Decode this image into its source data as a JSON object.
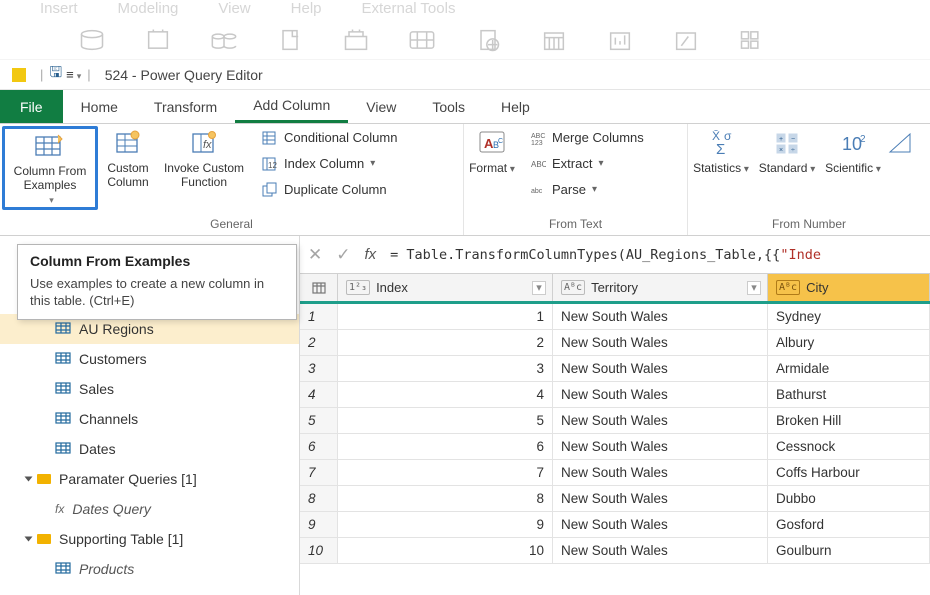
{
  "bgmenu": [
    "Insert",
    "Modeling",
    "View",
    "Help",
    "External Tools"
  ],
  "title": "524 - Power Query Editor",
  "tabs": {
    "file": "File",
    "home": "Home",
    "transform": "Transform",
    "addcolumn": "Add Column",
    "view": "View",
    "tools": "Tools",
    "help": "Help"
  },
  "ribbon": {
    "col_from_examples": "Column From\nExamples",
    "custom_column": "Custom\nColumn",
    "invoke_custom": "Invoke Custom\nFunction",
    "conditional": "Conditional Column",
    "index": "Index Column",
    "duplicate": "Duplicate Column",
    "general": "General",
    "format": "Format",
    "merge": "Merge Columns",
    "extract": "Extract",
    "parse": "Parse",
    "from_text": "From Text",
    "statistics": "Statistics",
    "standard": "Standard",
    "scientific": "Scientific",
    "from_number": "From Number"
  },
  "tooltip": {
    "title": "Column From Examples",
    "body": "Use examples to create a new column in this table. (Ctrl+E)"
  },
  "queries": {
    "items": [
      {
        "label": "AU Regions",
        "type": "table",
        "selected": true
      },
      {
        "label": "Customers",
        "type": "table"
      },
      {
        "label": "Sales",
        "type": "table"
      },
      {
        "label": "Channels",
        "type": "table"
      },
      {
        "label": "Dates",
        "type": "table"
      }
    ],
    "groups": [
      {
        "label": "Paramater Queries [1]",
        "items": [
          {
            "label": "Dates Query",
            "type": "fx"
          }
        ]
      },
      {
        "label": "Supporting Table [1]",
        "items": [
          {
            "label": "Products",
            "type": "table"
          }
        ]
      }
    ]
  },
  "formula_prefix": "= Table.TransformColumnTypes(AU_Regions_Table,{{",
  "formula_string": "\"Inde",
  "columns": {
    "index": "Index",
    "territory": "Territory",
    "city": "City",
    "type_num": "1²₃",
    "type_text": "Aᴮc"
  },
  "rows": [
    {
      "n": 1,
      "index": 1,
      "territory": "New South Wales",
      "city": "Sydney"
    },
    {
      "n": 2,
      "index": 2,
      "territory": "New South Wales",
      "city": "Albury"
    },
    {
      "n": 3,
      "index": 3,
      "territory": "New South Wales",
      "city": "Armidale"
    },
    {
      "n": 4,
      "index": 4,
      "territory": "New South Wales",
      "city": "Bathurst"
    },
    {
      "n": 5,
      "index": 5,
      "territory": "New South Wales",
      "city": "Broken Hill"
    },
    {
      "n": 6,
      "index": 6,
      "territory": "New South Wales",
      "city": "Cessnock"
    },
    {
      "n": 7,
      "index": 7,
      "territory": "New South Wales",
      "city": "Coffs Harbour"
    },
    {
      "n": 8,
      "index": 8,
      "territory": "New South Wales",
      "city": "Dubbo"
    },
    {
      "n": 9,
      "index": 9,
      "territory": "New South Wales",
      "city": "Gosford"
    },
    {
      "n": 10,
      "index": 10,
      "territory": "New South Wales",
      "city": "Goulburn"
    }
  ]
}
